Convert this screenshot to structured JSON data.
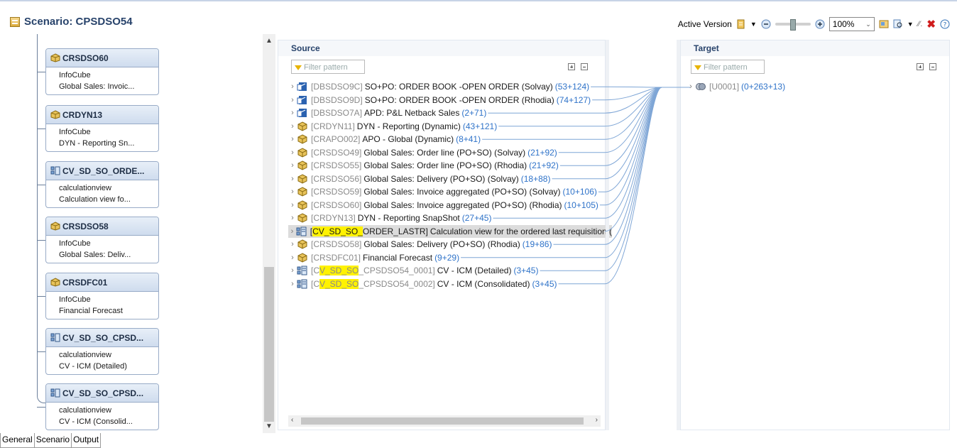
{
  "header": {
    "title": "Scenario: CPSDSO54",
    "active_version_label": "Active Version",
    "zoom_value": "100%"
  },
  "left_nodes": [
    {
      "name": "CRSDSO60",
      "type": "InfoCube",
      "desc": "Global Sales: Invoic...",
      "icon": "infocube-icon"
    },
    {
      "name": "CRDYN13",
      "type": "InfoCube",
      "desc": "DYN - Reporting Sn...",
      "icon": "infocube-icon"
    },
    {
      "name": "CV_SD_SO_ORDE...",
      "type": "calculationview",
      "desc": "Calculation view  fo...",
      "icon": "calcview-icon"
    },
    {
      "name": "CRSDSO58",
      "type": "InfoCube",
      "desc": "Global Sales: Deliv...",
      "icon": "infocube-icon"
    },
    {
      "name": "CRSDFC01",
      "type": "InfoCube",
      "desc": "Financial Forecast",
      "icon": "infocube-icon"
    },
    {
      "name": "CV_SD_SO_CPSD...",
      "type": "calculationview",
      "desc": "CV - ICM (Detailed)",
      "icon": "calcview-icon"
    },
    {
      "name": "CV_SD_SO_CPSD...",
      "type": "calculationview",
      "desc": "CV - ICM (Consolid...",
      "icon": "calcview-icon"
    }
  ],
  "source": {
    "heading": "Source",
    "filter_placeholder": "Filter pattern",
    "rows": [
      {
        "tech": "[DBSDSO9C]",
        "desc": "SO+PO: ORDER BOOK -OPEN ORDER (Solvay)",
        "count": "(53+124)",
        "icon": "apd-icon"
      },
      {
        "tech": "[DBSDSO9D]",
        "desc": "SO+PO: ORDER BOOK -OPEN ORDER (Rhodia)",
        "count": "(74+127)",
        "icon": "apd-icon"
      },
      {
        "tech": "[DBSDSO7A]",
        "desc": "APD: P&L Netback Sales",
        "count": "(2+71)",
        "icon": "apd-icon"
      },
      {
        "tech": "[CRDYN11]",
        "desc": "DYN - Reporting (Dynamic)",
        "count": "(43+121)",
        "icon": "infocube-icon"
      },
      {
        "tech": "[CRAPO002]",
        "desc": "APO - Global (Dynamic)",
        "count": "(8+41)",
        "icon": "infocube-icon"
      },
      {
        "tech": "[CRSDSO49]",
        "desc": "Global Sales: Order line (PO+SO) (Solvay)",
        "count": "(21+92)",
        "icon": "infocube-icon"
      },
      {
        "tech": "[CRSDSO55]",
        "desc": "Global Sales: Order line (PO+SO) (Rhodia)",
        "count": "(21+92)",
        "icon": "infocube-icon"
      },
      {
        "tech": "[CRSDSO56]",
        "desc": "Global Sales: Delivery (PO+SO) (Solvay)",
        "count": "(18+88)",
        "icon": "infocube-icon"
      },
      {
        "tech": "[CRSDSO59]",
        "desc": "Global Sales: Invoice aggregated (PO+SO) (Solvay)",
        "count": "(10+106)",
        "icon": "infocube-icon"
      },
      {
        "tech": "[CRSDSO60]",
        "desc": "Global Sales: Invoice aggregated (PO+SO) (Rhodia)",
        "count": "(10+105)",
        "icon": "infocube-icon"
      },
      {
        "tech": "[CRDYN13]",
        "desc": "DYN - Reporting SnapShot",
        "count": "(27+45)",
        "icon": "infocube-icon"
      },
      {
        "tech_hl": "CV_SD_SO_",
        "tech_rest": "ORDER_LASTR]",
        "desc": "Calculation view  for the ordered last requisition (",
        "count": "",
        "icon": "calcview-icon",
        "selected": true
      },
      {
        "tech": "[CRSDSO58]",
        "desc": "Global Sales: Delivery (PO+SO) (Rhodia)",
        "count": "(19+86)",
        "icon": "infocube-icon"
      },
      {
        "tech": "[CRSDFC01]",
        "desc": "Financial Forecast",
        "count": "(9+29)",
        "icon": "infocube-icon"
      },
      {
        "tech_pre": "[C",
        "tech_hl": "V_SD_SO",
        "tech_rest": "_CPSDSO54_0001]",
        "desc": "CV - ICM (Detailed)",
        "count": "(3+45)",
        "icon": "calcview-icon"
      },
      {
        "tech_pre": "[C",
        "tech_hl": "V_SD_SO",
        "tech_rest": "_CPSDSO54_0002]",
        "desc": "CV - ICM (Consolidated)",
        "count": "(3+45)",
        "icon": "calcview-icon"
      }
    ]
  },
  "target": {
    "heading": "Target",
    "filter_placeholder": "Filter pattern",
    "row": {
      "tech": "[U0001]",
      "count": "(0+263+13)",
      "icon": "union-icon"
    }
  },
  "tabs": [
    "General",
    "Scenario",
    "Output"
  ],
  "colors": {
    "accent": "#28436b",
    "count": "#2f73c9",
    "highlight": "#fff200",
    "line": "#7fa6d6"
  }
}
